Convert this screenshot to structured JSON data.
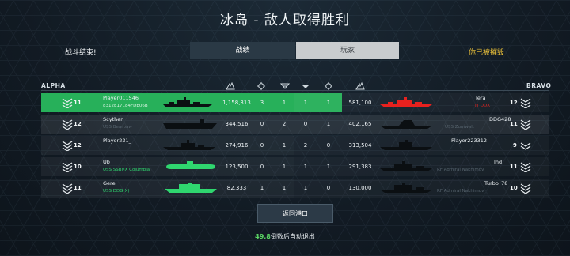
{
  "title": "冰岛 - 敌人取得胜利",
  "top_bar": {
    "left_text": "战斗结束!",
    "tabs": [
      "战绩",
      "玩家"
    ],
    "right_text": "你已被摧毁"
  },
  "teams": {
    "left": "ALPHA",
    "right": "BRAVO"
  },
  "columns": [
    "damage-icon",
    "kills-icon",
    "assists-icon",
    "ships-sunk-icon",
    "captures-icon",
    "damage-taken-icon"
  ],
  "colors": {
    "highlight": "#27b05a",
    "player_ship": "#2fd66f",
    "enemy_highlight": "#e8211e",
    "warning": "#f0c53a"
  },
  "rows": [
    {
      "left": {
        "level": "11",
        "name": "Player011546",
        "ship": "8312E17184FDE06B",
        "damage": "1,158,313",
        "kills": "3",
        "assists": "1"
      },
      "right": {
        "level": "12",
        "name": "Tera",
        "ship": "IT DDX",
        "caps": "1",
        "captures": "1",
        "damage_taken": "581,100"
      }
    },
    {
      "left": {
        "level": "12",
        "name": "Scyther",
        "ship": "USS Bearpaw",
        "damage": "344,516",
        "kills": "0",
        "assists": "2"
      },
      "right": {
        "level": "11",
        "name": "DDG428",
        "ship": "USS Zumwalt",
        "caps": "0",
        "captures": "1",
        "damage_taken": "402,165"
      }
    },
    {
      "left": {
        "level": "12",
        "name": "Player231_",
        "ship": "",
        "damage": "274,916",
        "kills": "0",
        "assists": "1"
      },
      "right": {
        "level": "9",
        "name": "Player223312",
        "ship": "",
        "caps": "2",
        "captures": "0",
        "damage_taken": "313,504"
      }
    },
    {
      "left": {
        "level": "10",
        "name": "Ub",
        "ship": "USS SSBNX Columbia",
        "damage": "123,500",
        "kills": "0",
        "assists": "1"
      },
      "right": {
        "level": "11",
        "name": "Ihd",
        "ship": "RF Admiral Nakhimov",
        "caps": "1",
        "captures": "1",
        "damage_taken": "291,383"
      }
    },
    {
      "left": {
        "level": "11",
        "name": "Gere",
        "ship": "USS DDG(X)",
        "damage": "82,333",
        "kills": "1",
        "assists": "1"
      },
      "right": {
        "level": "10",
        "name": "Turbo_78",
        "ship": "RF Admiral Nakhimov",
        "caps": "1",
        "captures": "0",
        "damage_taken": "130,000"
      }
    }
  ],
  "return_button": "返回港口",
  "countdown": {
    "seconds": "49.8",
    "suffix": "倒数后自动退出"
  }
}
